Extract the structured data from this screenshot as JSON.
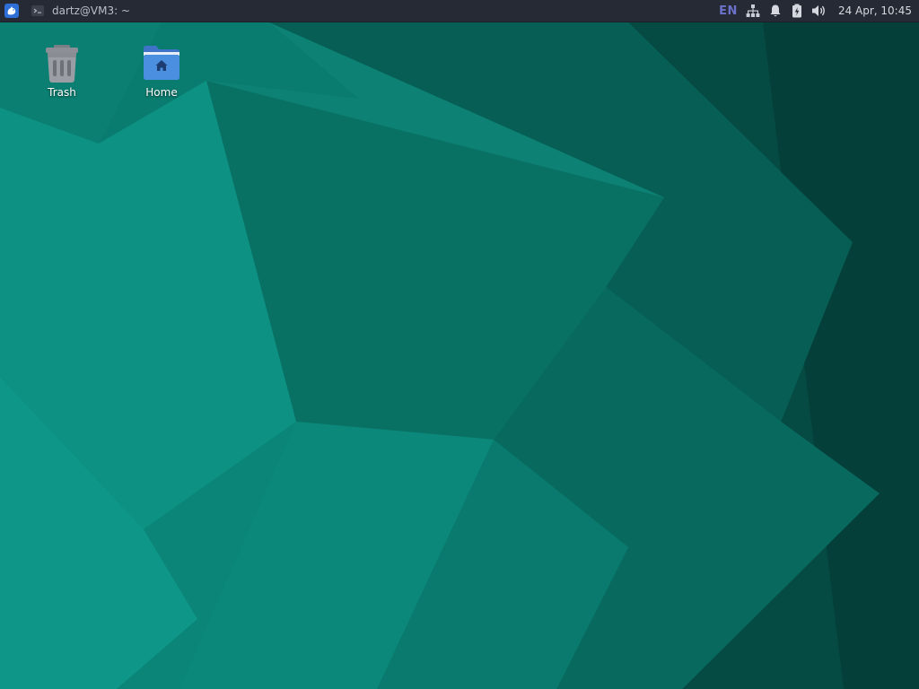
{
  "panel": {
    "app_menu_icon": "xfce-mouse-icon",
    "tasks": [
      {
        "icon": "terminal-icon",
        "title": "dartz@VM3: ~"
      }
    ],
    "tray": {
      "keyboard_layout": "EN",
      "network_icon": "network-wired-icon",
      "notifications_icon": "bell-icon",
      "power_icon": "battery-charging-icon",
      "volume_icon": "speaker-icon"
    },
    "clock": "24 Apr, 10:45"
  },
  "desktop": {
    "icons": [
      {
        "name": "trash",
        "icon": "trash-icon",
        "label": "Trash"
      },
      {
        "name": "home",
        "icon": "home-folder-icon",
        "label": "Home"
      }
    ]
  },
  "colors": {
    "panel_bg": "#262a35",
    "wallpaper_base": "#0a6e63",
    "keyboard_layout": "#6c72c9",
    "folder_blue": "#4a8fe0"
  }
}
